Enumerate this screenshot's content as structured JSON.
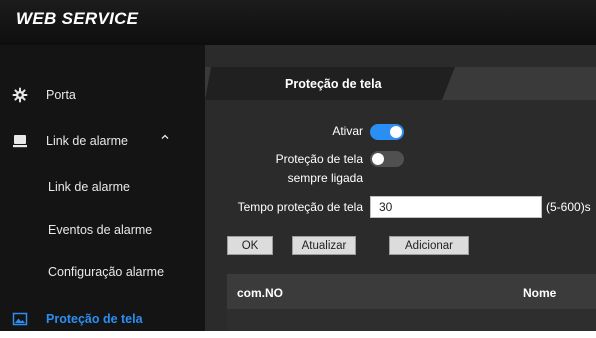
{
  "app": {
    "title": "WEB SERVICE"
  },
  "sidebar": {
    "items": [
      {
        "label": "Porta",
        "icon": "gear-icon"
      },
      {
        "label": "Link de alarme",
        "icon": "monitor-icon",
        "expanded": true
      },
      {
        "label": "Link de alarme"
      },
      {
        "label": "Eventos de alarme"
      },
      {
        "label": "Configuração alarme"
      },
      {
        "label": "Proteção de tela",
        "icon": "image-icon",
        "active": true
      }
    ]
  },
  "main": {
    "tab": {
      "label": "Proteção de tela"
    },
    "form": {
      "ativar_label": "Ativar",
      "ativar_on": true,
      "sempre_label_1": "Proteção de tela",
      "sempre_label_2": "sempre ligada",
      "sempre_on": false,
      "tempo_label": "Tempo proteção de tela",
      "tempo_value": "30",
      "tempo_range": "(5-600)s"
    },
    "buttons": {
      "ok": "OK",
      "atualizar": "Atualizar",
      "adicionar": "Adicionar"
    },
    "table": {
      "headers": [
        "com.NO",
        "Nome"
      ]
    }
  },
  "colors": {
    "accent": "#2b8ef2",
    "sidebar_bg": "#141414",
    "content_bg": "#2b2b2b",
    "header_bg": "#121212"
  }
}
